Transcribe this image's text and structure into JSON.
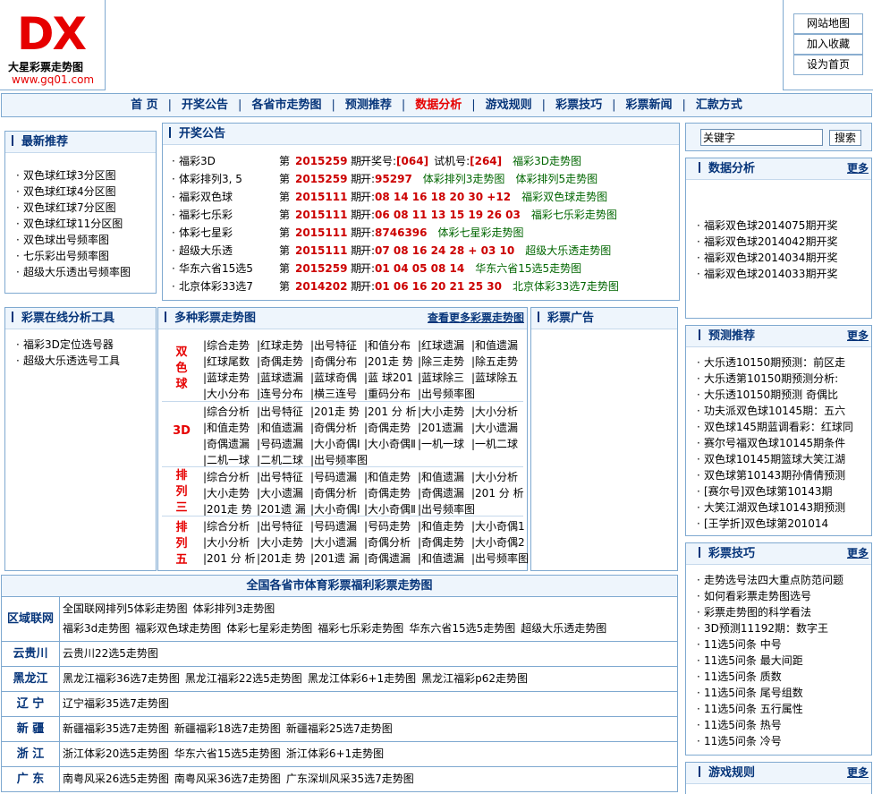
{
  "logo": {
    "mark": "DX",
    "name": "大星彩票走势图",
    "url": "www.gq01.com"
  },
  "top_links": [
    "网站地图",
    "加入收藏",
    "设为首页"
  ],
  "nav": {
    "items": [
      "首 页",
      "开奖公告",
      "各省市走势图",
      "预测推荐",
      "数据分析",
      "游戏规则",
      "彩票技巧",
      "彩票新闻",
      "汇款方式"
    ],
    "active": "数据分析"
  },
  "latest": {
    "title": "最新推荐",
    "items": [
      "双色球红球3分区图",
      "双色球红球4分区图",
      "双色球红球7分区图",
      "双色球红球11分区图",
      "双色球出号频率图",
      "七乐彩出号频率图",
      "超级大乐透出号频率图"
    ]
  },
  "tools": {
    "title": "彩票在线分析工具",
    "items": [
      "福彩3D定位选号器",
      "超级大乐透选号工具"
    ]
  },
  "draws": {
    "title": "开奖公告",
    "rows": [
      {
        "game": "福彩3D",
        "di": "第",
        "issue": "2015259",
        "qi": "期",
        "result_prefix": "开奖号:",
        "result": "[064]",
        "extra_prefix": "试机号:",
        "extra": "[264]",
        "link": "福彩3D走势图"
      },
      {
        "game": "体彩排列3, 5",
        "di": "第",
        "issue": "2015259",
        "qi": "期",
        "result_prefix": "开:",
        "result": "95297",
        "extra_prefix": "",
        "extra": "",
        "link": "体彩排列3走势图",
        "link2": "体彩排列5走势图"
      },
      {
        "game": "福彩双色球",
        "di": "第",
        "issue": "2015111",
        "qi": "期",
        "result_prefix": "开:",
        "result": "08 14 16 18 20 30 +12",
        "extra_prefix": "",
        "extra": "",
        "link": "福彩双色球走势图"
      },
      {
        "game": "福彩七乐彩",
        "di": "第",
        "issue": "2015111",
        "qi": "期",
        "result_prefix": "开:",
        "result": "06 08 11 13 15 19 26 03",
        "extra_prefix": "",
        "extra": "",
        "link": "福彩七乐彩走势图"
      },
      {
        "game": "体彩七星彩",
        "di": "第",
        "issue": "2015111",
        "qi": "期",
        "result_prefix": "开:",
        "result": "8746396",
        "extra_prefix": "",
        "extra": "",
        "link": "体彩七星彩走势图"
      },
      {
        "game": "超级大乐透",
        "di": "第",
        "issue": "2015111",
        "qi": "期",
        "result_prefix": "开:",
        "result": "07 08 16 24 28 + 03 10",
        "extra_prefix": "",
        "extra": "",
        "link": "超级大乐透走势图"
      },
      {
        "game": "华东六省15选5",
        "di": "第",
        "issue": "2015259",
        "qi": "期",
        "result_prefix": "开:",
        "result": "01 04 05 08 14",
        "extra_prefix": "",
        "extra": "",
        "link": "华东六省15选5走势图"
      },
      {
        "game": "北京体彩33选7",
        "di": "第",
        "issue": "2014202",
        "qi": "期",
        "result_prefix": "开:",
        "result": "01 06 16 20 21 25 30",
        "extra_prefix": "",
        "extra": "",
        "link": "北京体彩33选7走势图"
      }
    ]
  },
  "trends": {
    "title": "多种彩票走势图",
    "more": "查看更多彩票走势图",
    "groups": [
      {
        "label": "双色球",
        "items": [
          "|综合走势",
          "|红球走势",
          "|出号特征",
          "|和值分布",
          "|红球遗漏",
          "|和值遗漏",
          "|红球尾数",
          "|奇偶走势",
          "|奇偶分布",
          "|201走 势",
          "|除三走势",
          "|除五走势",
          "|蓝球走势",
          "|蓝球遗漏",
          "|蓝球奇偶",
          "|蓝 球201",
          "|蓝球除三",
          "|蓝球除五",
          "|大小分布",
          "|连号分布",
          "|横三连号",
          "|重码分布",
          "|出号频率图"
        ]
      },
      {
        "label": "3D",
        "items": [
          "|综合分析",
          "|出号特征",
          "|201走 势",
          "|201 分 析",
          "|大小走势",
          "|大小分析",
          "|和值走势",
          "|和值遗漏",
          "|奇偶分析",
          "|奇偶走势",
          "|201遗漏",
          "|大小遗漏",
          "|奇偶遗漏",
          "|号码遗漏",
          "|大小奇偶Ⅰ",
          "|大小奇偶Ⅱ",
          "|一机一球",
          "|一机二球",
          "|二机一球",
          "|二机二球",
          "|出号频率图"
        ]
      },
      {
        "label": "排列三",
        "items": [
          "|综合分析",
          "|出号特征",
          "|号码遗漏",
          "|和值走势",
          "|和值遗漏",
          "|大小分析",
          "|大小走势",
          "|大小遗漏",
          "|奇偶分析",
          "|奇偶走势",
          "|奇偶遗漏",
          "|201 分 析",
          "|201走 势",
          "|201遗 漏",
          "|大小奇偶Ⅰ",
          "|大小奇偶Ⅱ",
          "|出号频率图"
        ]
      },
      {
        "label": "排列五",
        "items": [
          "|综合分析",
          "|出号特征",
          "|号码遗漏",
          "|号码走势",
          "|和值走势",
          "|大小奇偶1",
          "|大小分析",
          "|大小走势",
          "|大小遗漏",
          "|奇偶分析",
          "|奇偶走势",
          "|大小奇偶2",
          "|201 分 析",
          "|201走 势",
          "|201遗 漏",
          "|奇偶遗漏",
          "|和值遗漏",
          "|出号频率图"
        ]
      }
    ]
  },
  "ads": {
    "title": "彩票广告"
  },
  "search": {
    "placeholder": "关键字",
    "button": "搜索"
  },
  "analysis": {
    "title": "数据分析",
    "more": "更多",
    "items": [
      "福彩双色球2014075期开奖",
      "福彩双色球2014042期开奖",
      "福彩双色球2014034期开奖",
      "福彩双色球2014033期开奖"
    ]
  },
  "forecast": {
    "title": "预测推荐",
    "more": "更多",
    "items": [
      "大乐透10150期预测：前区走",
      "大乐透第10150期预测分析:",
      "大乐透10150期预测 奇偶比",
      "功夫派双色球10145期：五六",
      "双色球145期蓝调看彩：红球同",
      "赛尔号福双色球10145期条件",
      "双色球10145期篮球大笑江湖",
      "双色球第10143期孙倩倩预测",
      "[赛尔号]双色球第10143期",
      "大笑江湖双色球10143期预测",
      "[王学折]双色球第201014"
    ]
  },
  "tips": {
    "title": "彩票技巧",
    "more": "更多",
    "items": [
      "走势选号法四大重点防范问题",
      "如何看彩票走势图选号",
      "彩票走势图的科学看法",
      "3D预测11192期：数字王",
      "11选5问条 中号",
      "11选5问条 最大间距",
      "11选5问条 质数",
      "11选5问条 尾号组数",
      "11选5问条 五行属性",
      "11选5问条 热号",
      "11选5问条 冷号"
    ]
  },
  "rules": {
    "title": "游戏规则",
    "more": "更多"
  },
  "provinces": {
    "title": "全国各省市体育彩票福利彩票走势图",
    "rows": [
      {
        "name": "区域联网",
        "lines": [
          [
            "全国联网排列5体彩走势图",
            "体彩排列3走势图"
          ],
          [
            "福彩3d走势图",
            "福彩双色球走势图",
            "体彩七星彩走势图",
            "福彩七乐彩走势图",
            "华东六省15选5走势图",
            "超级大乐透走势图"
          ]
        ]
      },
      {
        "name": "云贵川",
        "lines": [
          [
            "云贵川22选5走势图"
          ]
        ]
      },
      {
        "name": "黑龙江",
        "lines": [
          [
            "黑龙江福彩36选7走势图",
            "黑龙江福彩22选5走势图",
            "黑龙江体彩6+1走势图",
            "黑龙江福彩p62走势图"
          ]
        ]
      },
      {
        "name": "辽 宁",
        "lines": [
          [
            "辽宁福彩35选7走势图"
          ]
        ]
      },
      {
        "name": "新 疆",
        "lines": [
          [
            "新疆福彩35选7走势图",
            "新疆福彩18选7走势图",
            "新疆福彩25选7走势图"
          ]
        ]
      },
      {
        "name": "浙 江",
        "lines": [
          [
            "浙江体彩20选5走势图",
            "华东六省15选5走势图",
            "浙江体彩6+1走势图"
          ]
        ]
      },
      {
        "name": "广 东",
        "lines": [
          [
            "南粤风采26选5走势图",
            "南粤风采36选7走势图",
            "广东深圳风采35选7走势图"
          ]
        ]
      }
    ]
  }
}
